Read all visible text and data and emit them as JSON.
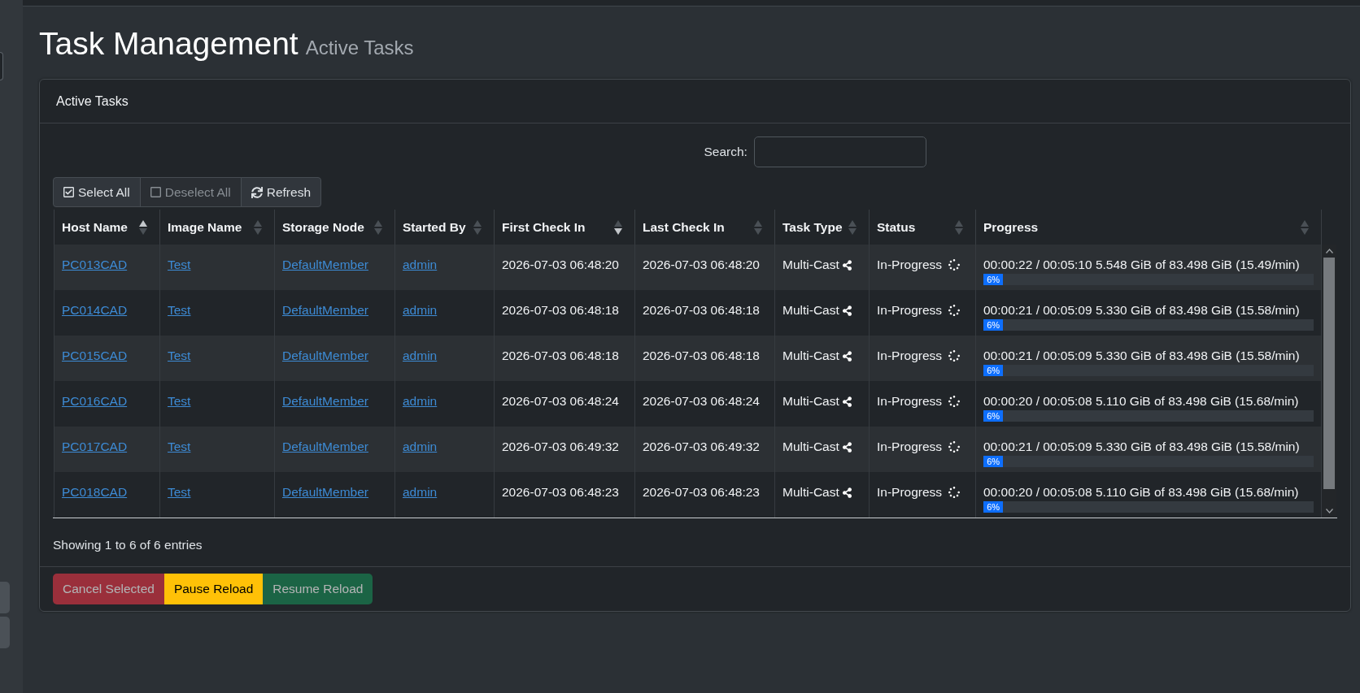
{
  "page_header": {
    "title": "Task Management",
    "subtitle": "Active Tasks"
  },
  "card": {
    "title": "Active Tasks"
  },
  "search": {
    "label": "Search:"
  },
  "toolbar": {
    "buttons": [
      {
        "kind": "select_all",
        "label": "Select All",
        "disabled": false
      },
      {
        "kind": "deselect_all",
        "label": "Deselect All",
        "disabled": true
      },
      {
        "kind": "refresh",
        "label": "Refresh",
        "disabled": false
      }
    ]
  },
  "table": {
    "columns": [
      {
        "label": "Host Name",
        "sorted_asc": true,
        "sorted_desc": false
      },
      {
        "label": "Image Name",
        "sorted_asc": false,
        "sorted_desc": false
      },
      {
        "label": "Storage Node",
        "sorted_asc": false,
        "sorted_desc": false
      },
      {
        "label": "Started By",
        "sorted_asc": false,
        "sorted_desc": false
      },
      {
        "label": "First Check In",
        "sorted_asc": false,
        "sorted_desc": true
      },
      {
        "label": "Last Check In",
        "sorted_asc": false,
        "sorted_desc": false
      },
      {
        "label": "Task Type",
        "sorted_asc": false,
        "sorted_desc": false
      },
      {
        "label": "Status",
        "sorted_asc": false,
        "sorted_desc": false
      },
      {
        "label": "Progress",
        "sorted_asc": false,
        "sorted_desc": false
      }
    ],
    "rows": [
      {
        "host_name": "PC013CAD",
        "image_name": "Test",
        "storage_node": "DefaultMember",
        "started_by": "admin",
        "first_check_in": "2026-07-03 06:48:20",
        "last_check_in": "2026-07-03 06:48:20",
        "task_type": "Multi-Cast",
        "status": "In-Progress",
        "progress_text": "00:00:22 / 00:05:10 5.548 GiB of 83.498 GiB (15.49/min)",
        "progress_label": "6%",
        "level": 0.06
      },
      {
        "host_name": "PC014CAD",
        "image_name": "Test",
        "storage_node": "DefaultMember",
        "started_by": "admin",
        "first_check_in": "2026-07-03 06:48:18",
        "last_check_in": "2026-07-03 06:48:18",
        "task_type": "Multi-Cast",
        "status": "In-Progress",
        "progress_text": "00:00:21 / 00:05:09 5.330 GiB of 83.498 GiB (15.58/min)",
        "progress_label": "6%",
        "level": 0.06
      },
      {
        "host_name": "PC015CAD",
        "image_name": "Test",
        "storage_node": "DefaultMember",
        "started_by": "admin",
        "first_check_in": "2026-07-03 06:48:18",
        "last_check_in": "2026-07-03 06:48:18",
        "task_type": "Multi-Cast",
        "status": "In-Progress",
        "progress_text": "00:00:21 / 00:05:09 5.330 GiB of 83.498 GiB (15.58/min)",
        "progress_label": "6%",
        "level": 0.06
      },
      {
        "host_name": "PC016CAD",
        "image_name": "Test",
        "storage_node": "DefaultMember",
        "started_by": "admin",
        "first_check_in": "2026-07-03 06:48:24",
        "last_check_in": "2026-07-03 06:48:24",
        "task_type": "Multi-Cast",
        "status": "In-Progress",
        "progress_text": "00:00:20 / 00:05:08 5.110 GiB of 83.498 GiB (15.68/min)",
        "progress_label": "6%",
        "level": 0.06
      },
      {
        "host_name": "PC017CAD",
        "image_name": "Test",
        "storage_node": "DefaultMember",
        "started_by": "admin",
        "first_check_in": "2026-07-03 06:49:32",
        "last_check_in": "2026-07-03 06:49:32",
        "task_type": "Multi-Cast",
        "status": "In-Progress",
        "progress_text": "00:00:21 / 00:05:09 5.330 GiB of 83.498 GiB (15.58/min)",
        "progress_label": "6%",
        "level": 0.06
      },
      {
        "host_name": "PC018CAD",
        "image_name": "Test",
        "storage_node": "DefaultMember",
        "started_by": "admin",
        "first_check_in": "2026-07-03 06:48:23",
        "last_check_in": "2026-07-03 06:48:23",
        "task_type": "Multi-Cast",
        "status": "In-Progress",
        "progress_text": "00:00:20 / 00:05:08 5.110 GiB of 83.498 GiB (15.68/min)",
        "progress_label": "6%",
        "level": 0.06
      }
    ]
  },
  "table_info": "Showing 1 to 6 of 6 entries",
  "footer_buttons": [
    {
      "kind": "danger",
      "label": "Cancel Selected",
      "disabled": true
    },
    {
      "kind": "warning",
      "label": "Pause Reload",
      "disabled": false
    },
    {
      "kind": "success",
      "label": "Resume Reload",
      "disabled": true
    }
  ]
}
